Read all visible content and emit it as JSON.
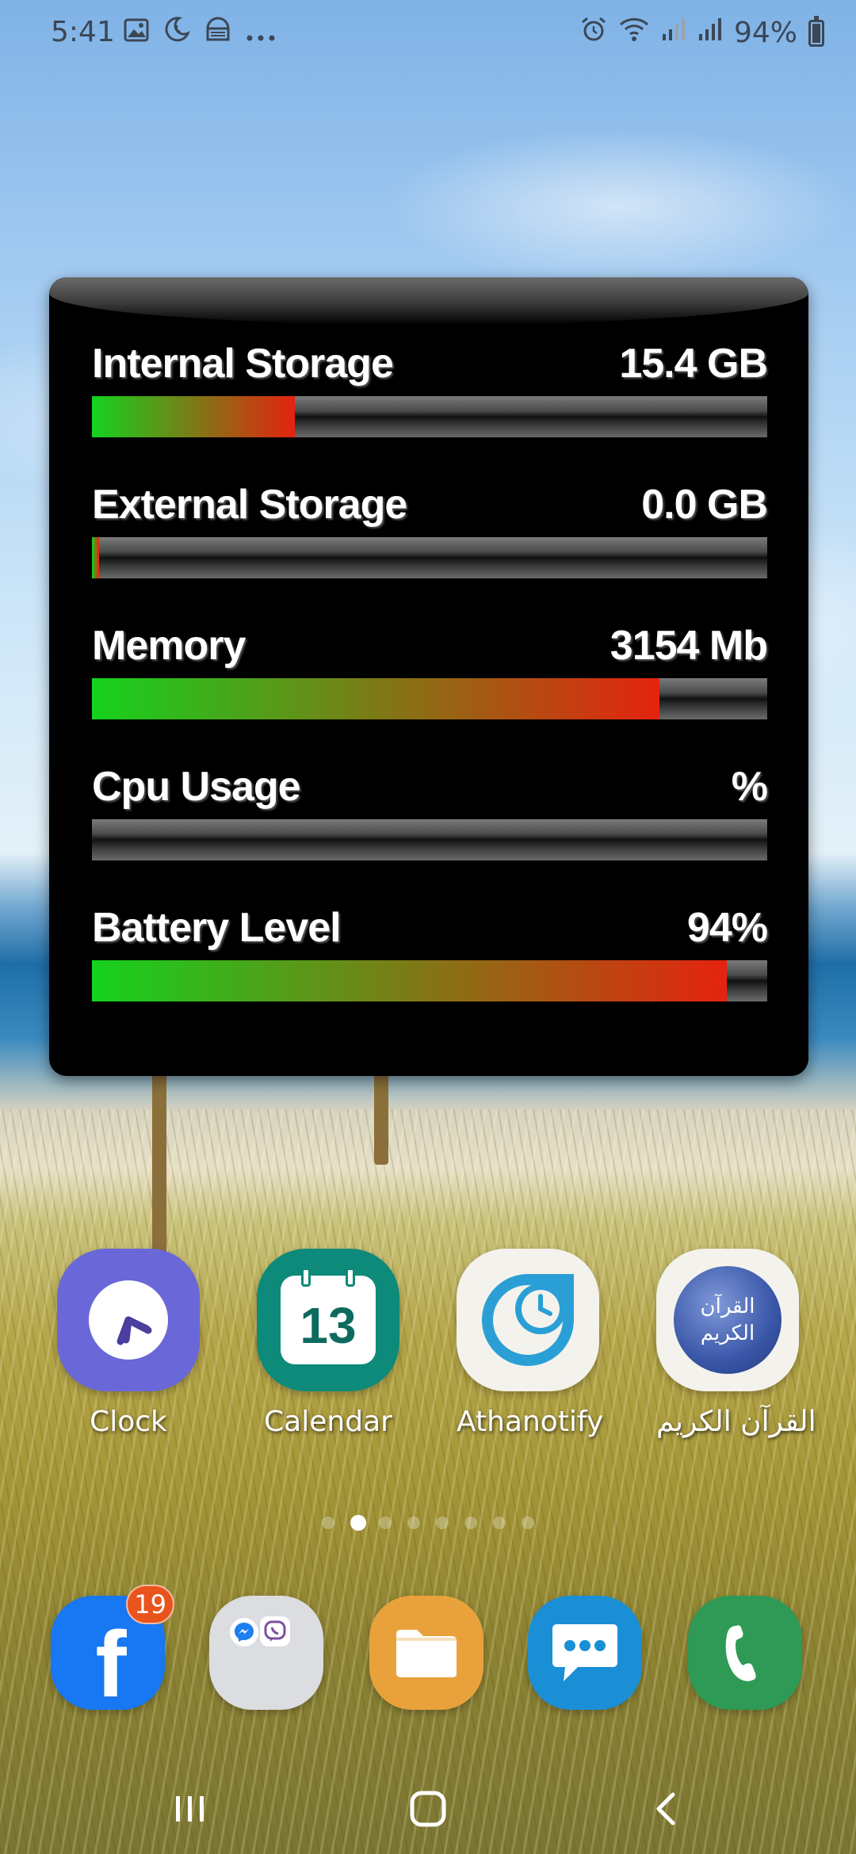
{
  "status_bar": {
    "time": "5:41",
    "left_icons": [
      "image-icon",
      "do-not-disturb-icon",
      "vpn-icon",
      "more-icon"
    ],
    "right_icons": [
      "alarm-icon",
      "wifi-icon",
      "signal-icon",
      "signal-icon"
    ],
    "battery_text": "94%",
    "battery_level": 0.94
  },
  "widget": {
    "metrics": [
      {
        "label": "Internal Storage",
        "value": "15.4 GB",
        "fill_fraction": 0.3,
        "colors": [
          "#14d21e",
          "#e5230f"
        ]
      },
      {
        "label": "External Storage",
        "value": "0.0 GB",
        "fill_fraction": 0.01,
        "colors": [
          "#14d21e",
          "#e5230f"
        ]
      },
      {
        "label": "Memory",
        "value": "3154 Mb",
        "fill_fraction": 0.84,
        "colors": [
          "#14d21e",
          "#e5230f"
        ]
      },
      {
        "label": "Cpu Usage",
        "value": "%",
        "fill_fraction": 0.0,
        "colors": [
          "#14d21e",
          "#e5230f"
        ]
      },
      {
        "label": "Battery Level",
        "value": "94%",
        "fill_fraction": 0.94,
        "colors": [
          "#14d21e",
          "#e5230f"
        ]
      }
    ]
  },
  "apps": [
    {
      "label": "Clock",
      "icon": "clock-icon",
      "bg": "#6a67d8"
    },
    {
      "label": "Calendar",
      "icon": "calendar-icon",
      "day": "13",
      "bg": "#0d8a7a"
    },
    {
      "label": "Athanotify",
      "icon": "athanotify-icon",
      "bg": "#f4f2ec"
    },
    {
      "label": "القرآن الكريم",
      "icon": "quran-icon",
      "icon_text": "القرآن الكريم",
      "bg": "#f4f2ec"
    }
  ],
  "dock": [
    {
      "name": "facebook",
      "icon": "facebook-icon",
      "badge": "19",
      "bg": "#1877f2"
    },
    {
      "name": "messaging-folder",
      "icon": "folder-icon",
      "bg": "#dcdde0"
    },
    {
      "name": "files",
      "icon": "files-icon",
      "bg": "#e9a23b"
    },
    {
      "name": "messages",
      "icon": "messages-icon",
      "bg": "#1a8fd6"
    },
    {
      "name": "phone",
      "icon": "phone-icon",
      "bg": "#2e9a55"
    }
  ],
  "page_indicator": {
    "count": 8,
    "active_index": 1
  },
  "nav": [
    "recent-apps-icon",
    "home-icon",
    "back-icon"
  ]
}
